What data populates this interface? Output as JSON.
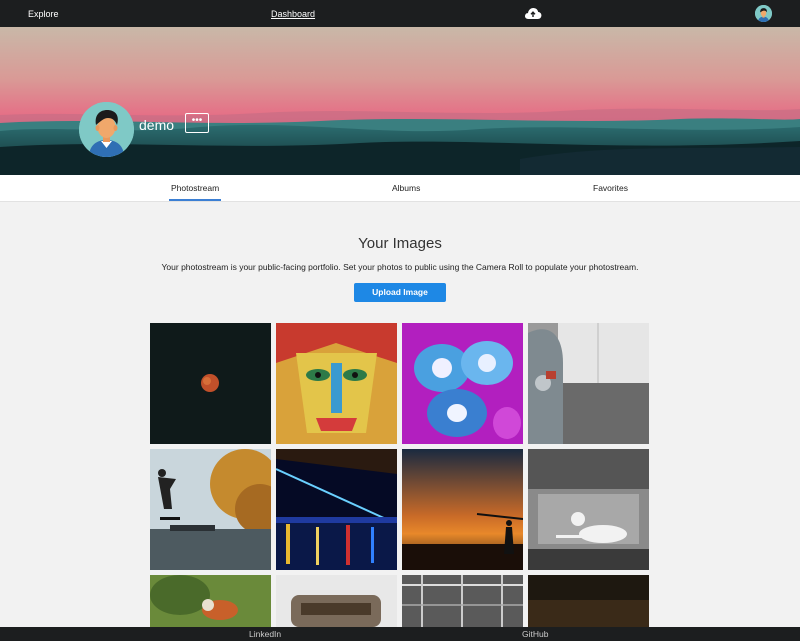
{
  "nav": {
    "explore": "Explore",
    "dashboard": "Dashboard",
    "upload_icon": "cloud-upload-icon",
    "avatar_icon": "user-avatar-icon"
  },
  "profile": {
    "username": "demo",
    "more_label": "•••"
  },
  "tabs": [
    {
      "label": "Photostream",
      "active": true
    },
    {
      "label": "Albums",
      "active": false
    },
    {
      "label": "Favorites",
      "active": false
    }
  ],
  "main": {
    "title": "Your Images",
    "subtitle": "Your photostream is your public-facing portfolio. Set your photos to public using the Camera Roll to populate your photostream.",
    "upload_button": "Upload Image"
  },
  "footer": {
    "linkedin": "LinkedIn",
    "github": "GitHub"
  },
  "colors": {
    "topbar": "#1c1e1f",
    "accent": "#1e88e5",
    "tab_underline": "#3b7fd4"
  }
}
